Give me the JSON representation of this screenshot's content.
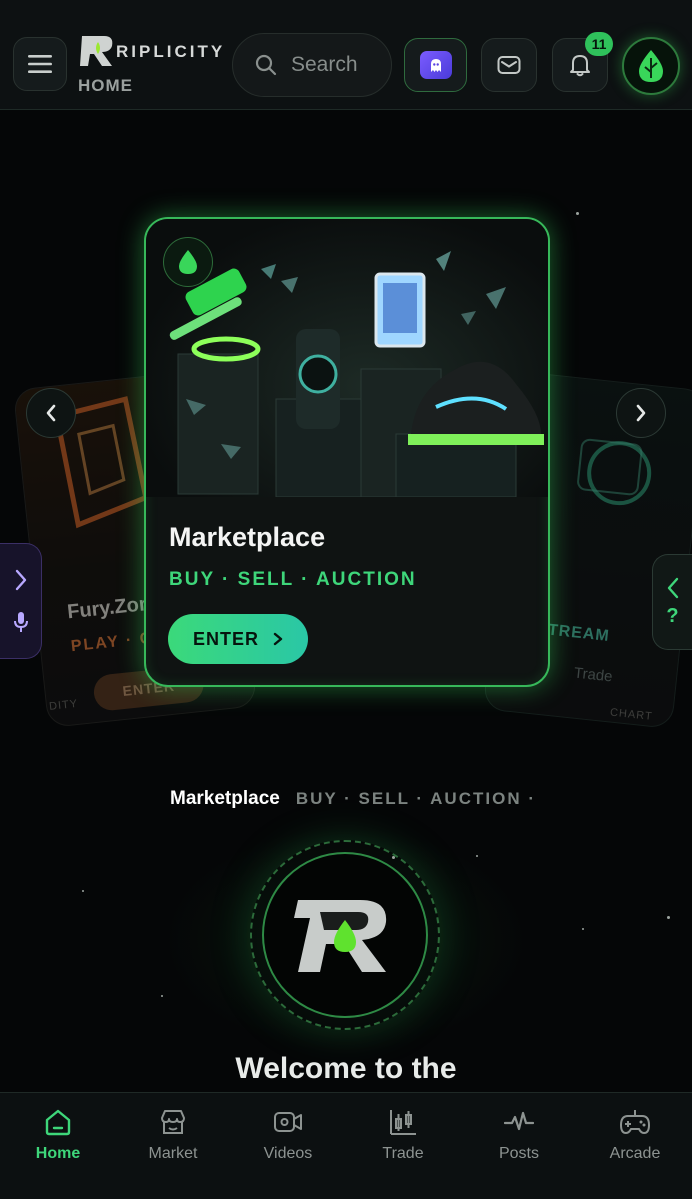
{
  "header": {
    "brand": "RIPLICITY",
    "page_label": "HOME",
    "search_placeholder": "Search",
    "notification_count": "11"
  },
  "carousel": {
    "main_card": {
      "title": "Marketplace",
      "subtitle": "BUY · SELL · AUCTION",
      "button": "ENTER"
    },
    "left_card": {
      "title": "Fury.Zon",
      "subtitle": "PLAY · CO",
      "button": "ENTER",
      "footer": "DITY"
    },
    "right_card": {
      "subtitle": "STREAM",
      "subtitle2": "Trade",
      "footer": "CHART"
    }
  },
  "side_tab_right": {
    "label": "?"
  },
  "caption": {
    "title": "Marketplace",
    "subtitle": "BUY · SELL · AUCTION ·"
  },
  "welcome": "Welcome to the",
  "bottom_nav": [
    {
      "label": "Home",
      "icon": "home-icon",
      "active": true
    },
    {
      "label": "Market",
      "icon": "store-icon"
    },
    {
      "label": "Videos",
      "icon": "video-icon"
    },
    {
      "label": "Trade",
      "icon": "candles-icon"
    },
    {
      "label": "Posts",
      "icon": "pulse-icon"
    },
    {
      "label": "Arcade",
      "icon": "gamepad-icon"
    }
  ],
  "colors": {
    "accent": "#3ed67a",
    "card_border": "#37b85a",
    "background": "#050607"
  }
}
